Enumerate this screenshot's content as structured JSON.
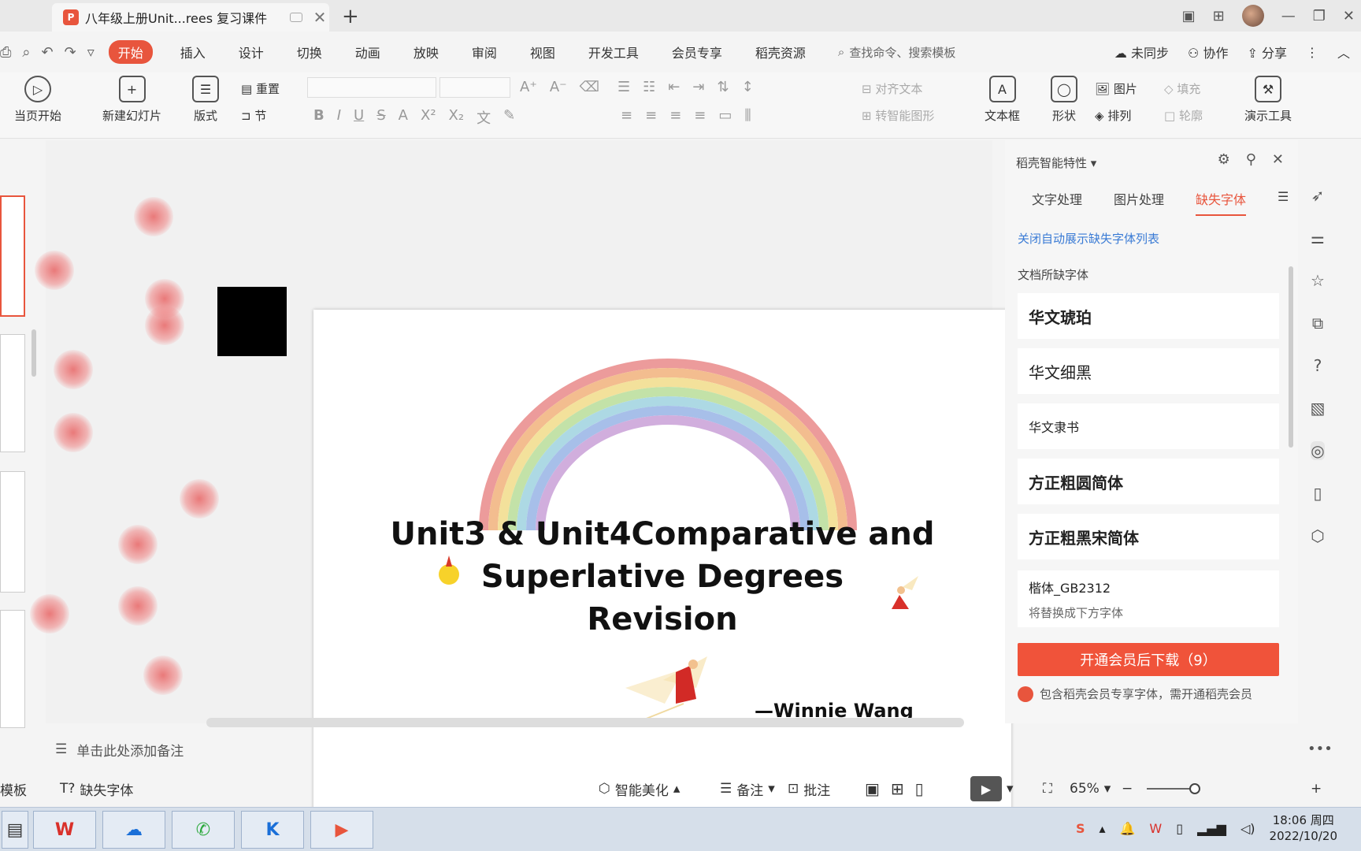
{
  "titlebar": {
    "tab_title": "八年级上册Unit...rees 复习课件",
    "tab_close": "✕",
    "new_tab": "+",
    "doc_icon_letter": "P"
  },
  "menu": {
    "items": [
      "开始",
      "插入",
      "设计",
      "切换",
      "动画",
      "放映",
      "审阅",
      "视图",
      "开发工具",
      "会员专享",
      "稻壳资源"
    ],
    "search_placeholder": "查找命令、搜索模板",
    "sync": "未同步",
    "collab": "协作",
    "share": "分享"
  },
  "ribbon": {
    "play_from_current": "当页开始",
    "new_slide": "新建幻灯片",
    "layout": "版式",
    "reset": "重置",
    "section": "节",
    "align_text": "对齐文本",
    "smart_shape": "转智能图形",
    "textbox": "文本框",
    "shape": "形状",
    "picture": "图片",
    "arrange": "排列",
    "fill": "填充",
    "outline": "轮廓",
    "present_tools": "演示工具"
  },
  "slide": {
    "title_line1": "Unit3 & Unit4Comparative and",
    "title_line2": "Superlative Degrees",
    "title_line3": "Revision",
    "author": "—Winnie Wang"
  },
  "notes_placeholder": "单击此处添加备注",
  "panel": {
    "header": "稻壳智能特性",
    "tabs": [
      "文字处理",
      "图片处理",
      "缺失字体"
    ],
    "active_tab_index": 2,
    "link": "关闭自动展示缺失字体列表",
    "subhead": "文档所缺字体",
    "fonts": [
      "华文琥珀",
      "华文细黑",
      "华文隶书",
      "方正粗圆简体",
      "方正粗黑宋简体"
    ],
    "last_font": "楷体_GB2312",
    "last_font_sub": "将替换成下方字体",
    "download_button": "开通会员后下载（9）",
    "note": "包含稻壳会员专享字体，需开通稻壳会员"
  },
  "statusbar": {
    "template": "模板",
    "missing_fonts": "缺失字体",
    "smart_beautify": "智能美化",
    "notes": "备注",
    "comments": "批注",
    "zoom": "65%"
  },
  "taskbar": {
    "time": "18:06 周四",
    "date": "2022/10/20"
  },
  "colors": {
    "accent": "#e8553d",
    "link": "#3a7bd5"
  }
}
